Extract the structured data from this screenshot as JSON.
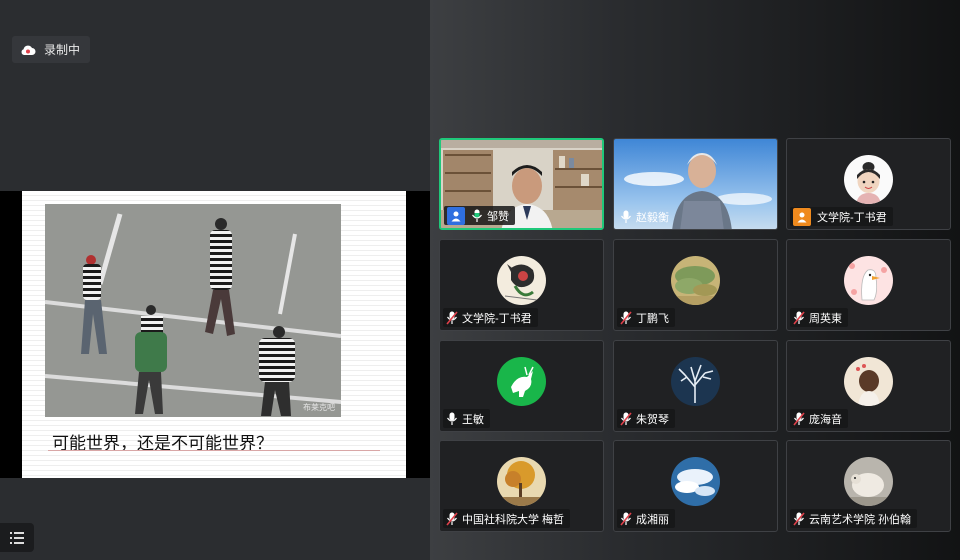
{
  "recording": {
    "label": "录制中"
  },
  "slide": {
    "photo_watermark": "布莱克吧",
    "caption": "可能世界，还是不可能世界？"
  },
  "participants": [
    {
      "name": "邹赞",
      "speaking": true,
      "video": "office",
      "badge": "user"
    },
    {
      "name": "赵毅衡",
      "speaking": false,
      "video": "sky",
      "badge": null
    },
    {
      "name": "文学院-丁书君",
      "speaking": false,
      "avatar": "girl-sketch",
      "badge": "user-orange"
    },
    {
      "name": "文学院-丁书君",
      "speaking": false,
      "avatar": "ink-figure",
      "badge": null
    },
    {
      "name": "丁鹏飞",
      "speaking": false,
      "avatar": "landscape-painting",
      "badge": null
    },
    {
      "name": "周英東",
      "speaking": false,
      "avatar": "goose-cartoon",
      "badge": null
    },
    {
      "name": "王敏",
      "speaking": false,
      "avatar": "green-deer",
      "badge": null
    },
    {
      "name": "朱贺琴",
      "speaking": false,
      "avatar": "white-tree",
      "badge": null
    },
    {
      "name": "庞海音",
      "speaking": false,
      "avatar": "girl-back",
      "badge": null
    },
    {
      "name": "中国社科院大学 梅哲",
      "speaking": false,
      "avatar": "autumn-tree",
      "badge": null
    },
    {
      "name": "成湘丽",
      "speaking": false,
      "avatar": "blue-clouds",
      "badge": null
    },
    {
      "name": "云南艺术学院 孙伯翰",
      "speaking": false,
      "avatar": "sheep",
      "badge": null
    }
  ],
  "colors": {
    "speaking_border": "#1fc87a",
    "user_badge_blue": "#2f6fe0",
    "user_badge_orange": "#ef8a1e",
    "muted_red": "#e0404a"
  },
  "icons": {
    "menu": "list-menu-icon",
    "record": "cloud-record-icon",
    "mic": "mic-icon",
    "mic_muted": "mic-muted-icon"
  }
}
